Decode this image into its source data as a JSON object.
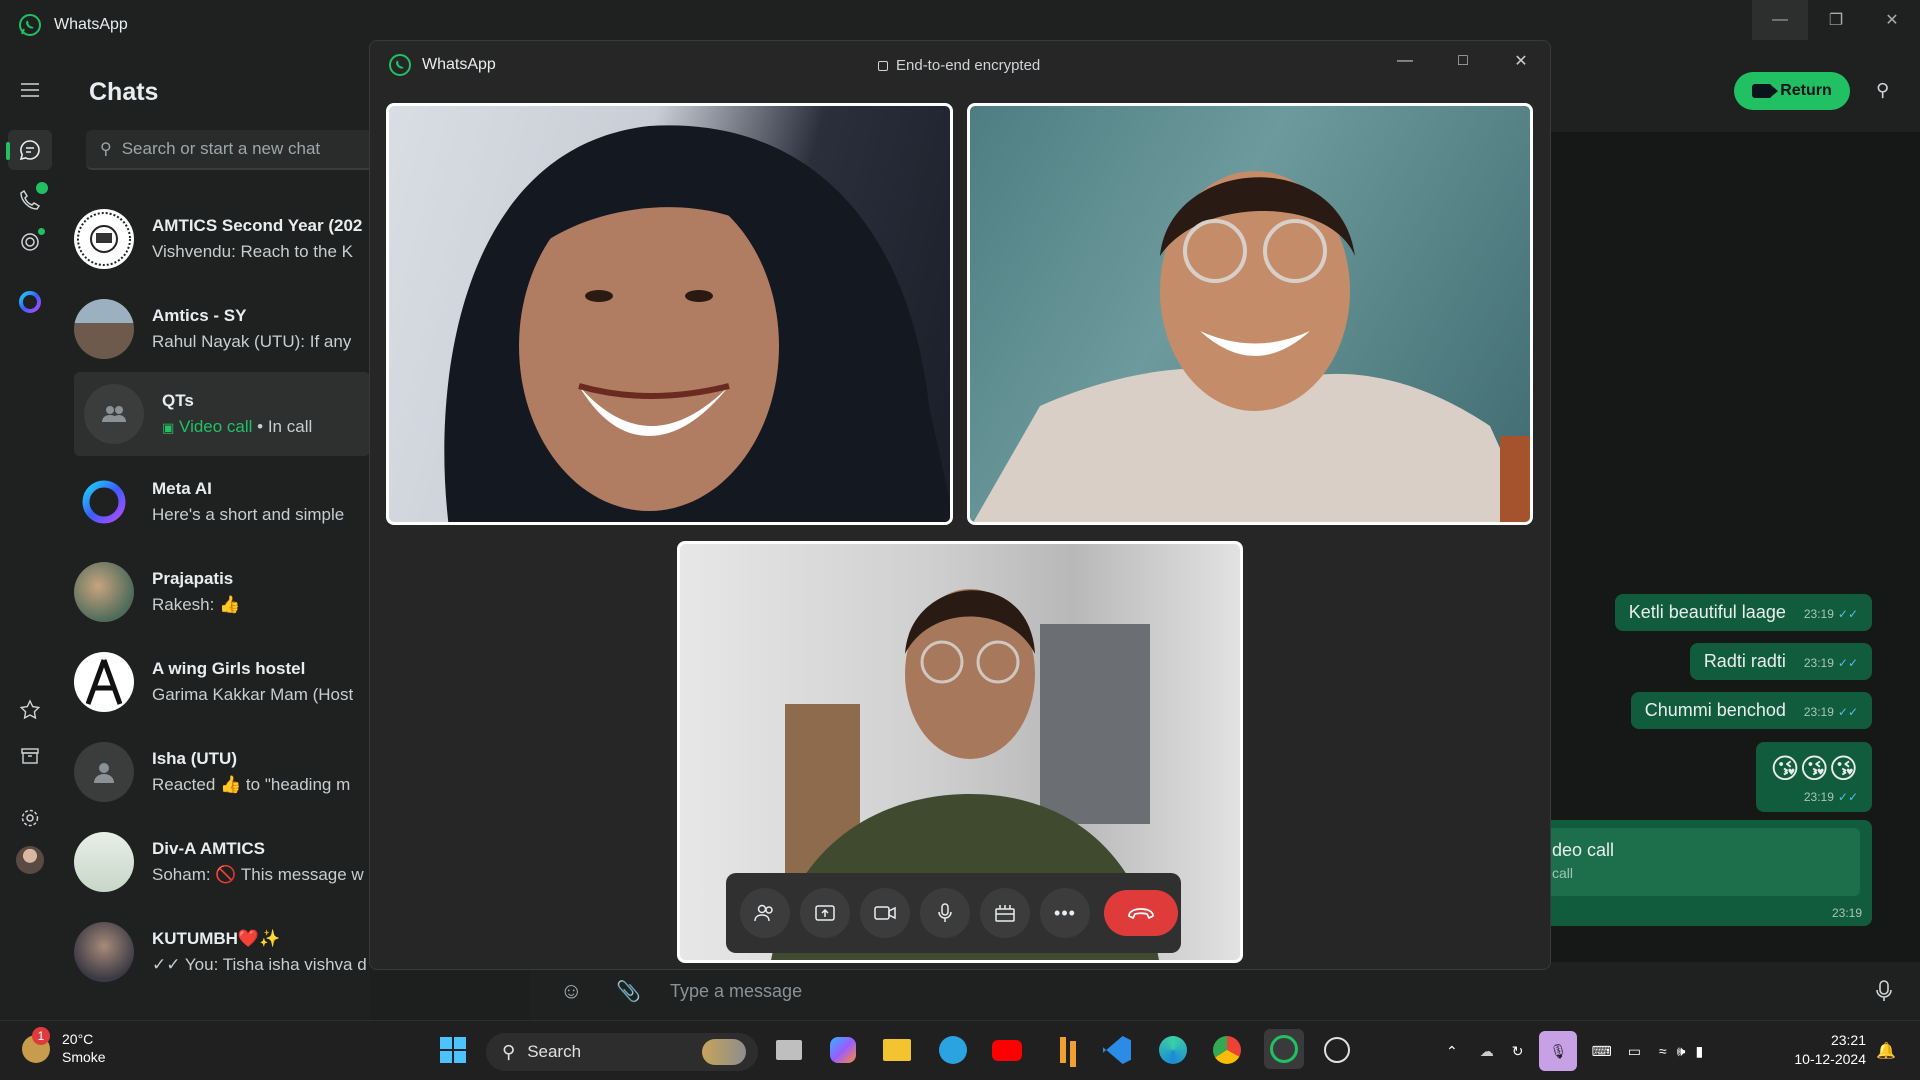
{
  "app": {
    "title": "WhatsApp"
  },
  "chatlist": {
    "header": "Chats",
    "search_placeholder": "Search or start a new chat",
    "items": [
      {
        "name": "AMTICS Second Year (202",
        "preview": "Vishvendu: Reach to the K"
      },
      {
        "name": "Amtics - SY",
        "preview": "Rahul Nayak (UTU): If any"
      },
      {
        "name": "QTs",
        "preview_green": "Video call",
        "preview": " • In call"
      },
      {
        "name": "Meta AI",
        "preview": "Here's a short and simple"
      },
      {
        "name": "Prajapatis",
        "preview": "Rakesh: 👍"
      },
      {
        "name": "A wing Girls hostel",
        "preview": "Garima Kakkar Mam (Host"
      },
      {
        "name": "Isha (UTU)",
        "preview": "Reacted 👍 to \"heading m"
      },
      {
        "name": "Div-A AMTICS",
        "preview": "Soham: 🚫 This message w"
      },
      {
        "name": "KUTUMBH❤️✨",
        "preview": "✓✓ You: Tisha isha vishva d"
      }
    ]
  },
  "call": {
    "title": "WhatsApp",
    "encryption": "End-to-end encrypted"
  },
  "conversation": {
    "return_label": "Return",
    "messages": [
      {
        "text": "Ketli beautiful laage",
        "time": "23:19"
      },
      {
        "text": "Radti radti",
        "time": "23:19"
      },
      {
        "text": "Chummi benchod",
        "time": "23:19"
      },
      {
        "text": "😘😘😘",
        "time": "23:19"
      }
    ],
    "call_card": {
      "title": "deo call",
      "subtitle": "call",
      "time": "23:19"
    },
    "compose_placeholder": "Type a message"
  },
  "taskbar": {
    "weather_temp": "20°C",
    "weather_desc": "Smoke",
    "weather_badge": "1",
    "search_label": "Search",
    "time": "23:21",
    "date": "10-12-2024"
  },
  "colors": {
    "accent": "#21c063",
    "end_call": "#e03b3b",
    "bubble": "#125c3e"
  }
}
